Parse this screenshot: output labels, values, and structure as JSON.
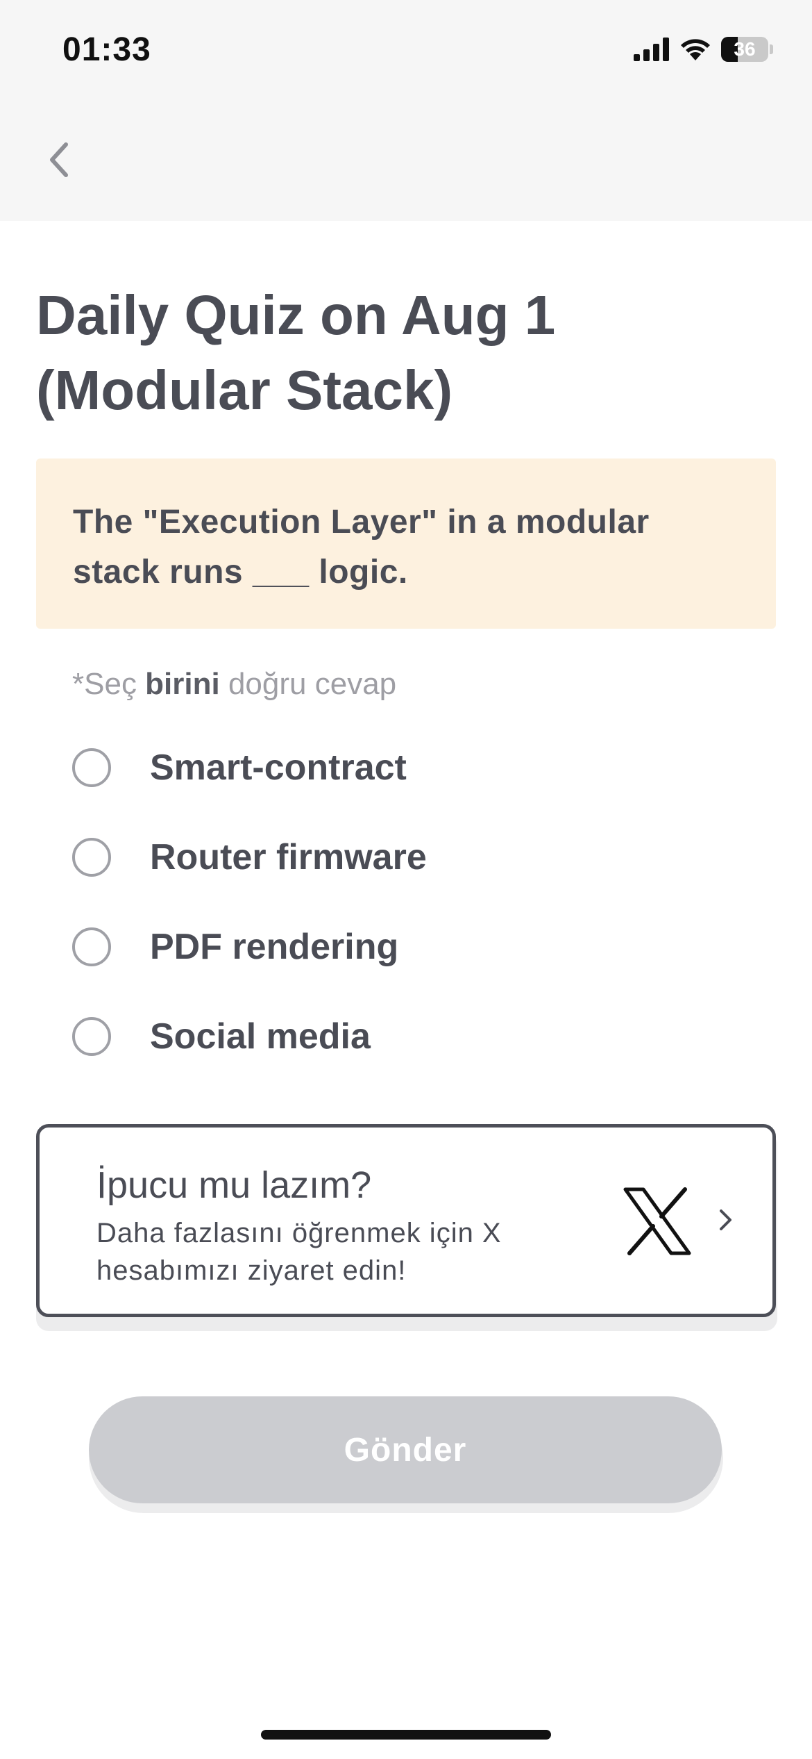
{
  "status_bar": {
    "time": "01:33",
    "battery_level": 36,
    "battery_text": "36"
  },
  "quiz": {
    "title": "Daily Quiz on Aug 1 (Modular Stack)",
    "question": "The \"Execution Layer\" in a modular stack runs ___ logic.",
    "instruction": {
      "prefix": "*Seç ",
      "emphasis": "birini",
      "suffix": " doğru cevap"
    },
    "options": [
      {
        "label": "Smart-contract",
        "selected": false
      },
      {
        "label": "Router firmware",
        "selected": false
      },
      {
        "label": "PDF rendering",
        "selected": false
      },
      {
        "label": "Social media",
        "selected": false
      }
    ]
  },
  "hint_card": {
    "title": "İpucu mu lazım?",
    "subtitle": "Daha fazlasını öğrenmek için X hesabımızı ziyaret edin!",
    "icon": "x-logo-icon"
  },
  "submit": {
    "label": "Gönder",
    "enabled": false
  },
  "colors": {
    "text": "#4a4c55",
    "question_bg": "#fdf1df",
    "header_bg": "#f6f6f6",
    "submit_disabled": "#cbccd0"
  }
}
